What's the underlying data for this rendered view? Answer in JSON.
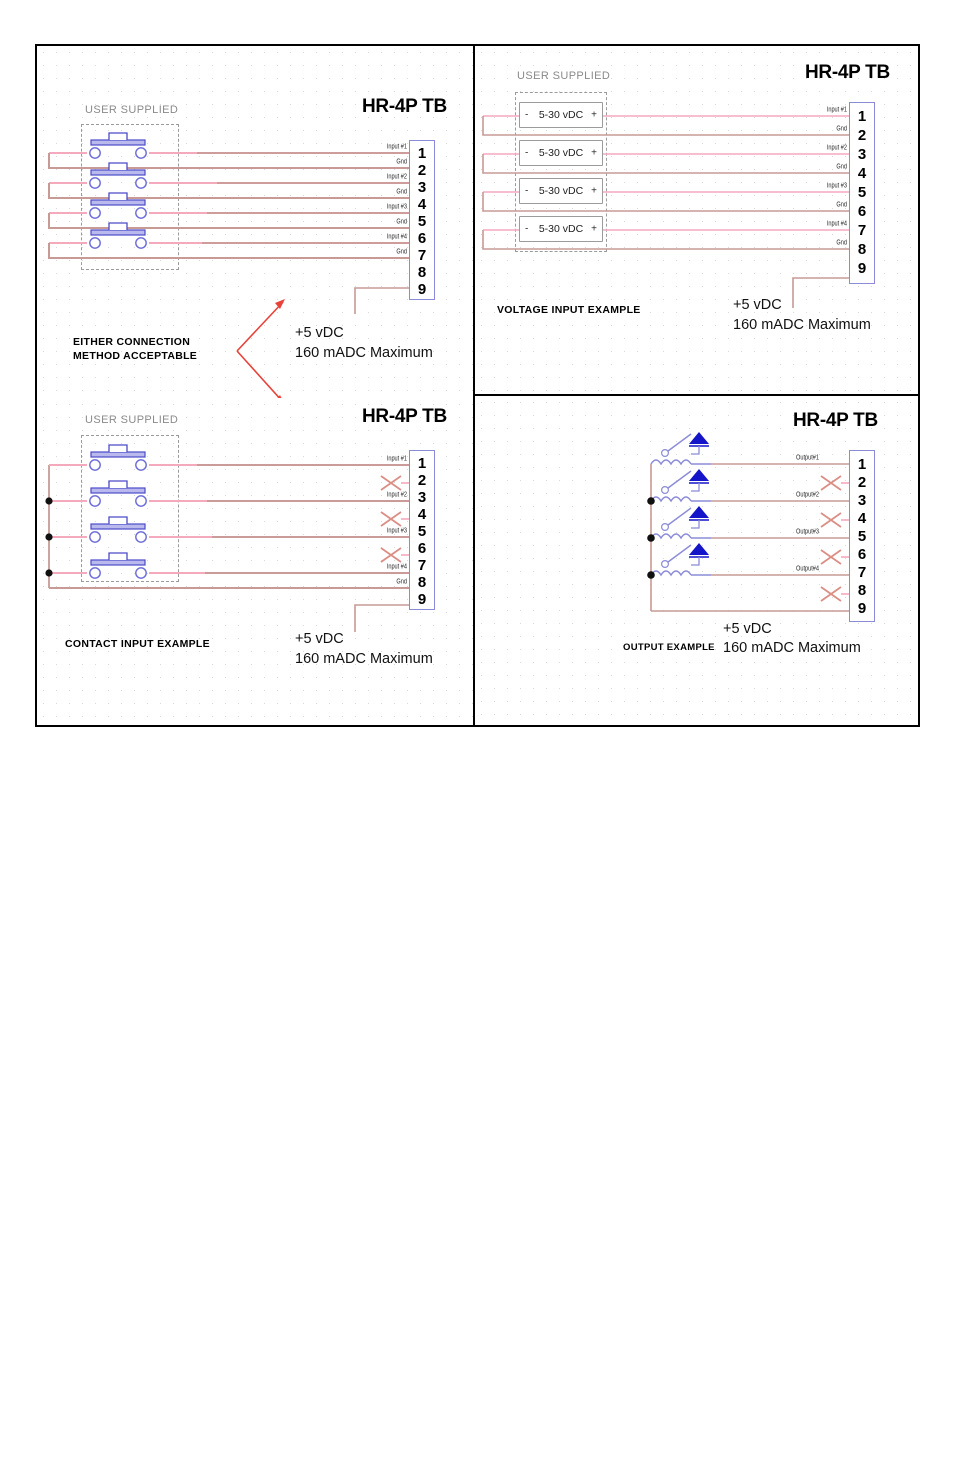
{
  "sheet": {
    "tb_title": "HR-4P TB",
    "user_supplied": "USER SUPPLIED",
    "power_line1": "+5 vDC",
    "power_line2": "160 mADC Maximum"
  },
  "panels": {
    "either": {
      "caption_line1": "EITHER CONNECTION",
      "caption_line2": "METHOD ACCEPTABLE",
      "tb_title": "HR-4P TB",
      "user_supplied": "USER SUPPLIED",
      "power_line1": "+5 vDC",
      "power_line2": "160 mADC Maximum",
      "pins": [
        "1",
        "2",
        "3",
        "4",
        "5",
        "6",
        "7",
        "8",
        "9"
      ],
      "pin_labels": [
        "Input #1",
        "Gnd",
        "Input #2",
        "Gnd",
        "Input #3",
        "Gnd",
        "Input #4",
        "Gnd",
        ""
      ],
      "switch_count": 4
    },
    "voltage": {
      "caption": "VOLTAGE INPUT EXAMPLE",
      "tb_title": "HR-4P TB",
      "user_supplied": "USER SUPPLIED",
      "power_line1": "+5 vDC",
      "power_line2": "160 mADC Maximum",
      "pins": [
        "1",
        "2",
        "3",
        "4",
        "5",
        "6",
        "7",
        "8",
        "9"
      ],
      "pin_labels": [
        "Input #1",
        "Gnd",
        "Input #2",
        "Gnd",
        "Input #3",
        "Gnd",
        "Input #4",
        "Gnd",
        ""
      ],
      "sources": [
        {
          "minus": "-",
          "label": "5-30 vDC",
          "plus": "+"
        },
        {
          "minus": "-",
          "label": "5-30 vDC",
          "plus": "+"
        },
        {
          "minus": "-",
          "label": "5-30 vDC",
          "plus": "+"
        },
        {
          "minus": "-",
          "label": "5-30 vDC",
          "plus": "+"
        }
      ]
    },
    "contact": {
      "caption": "CONTACT INPUT EXAMPLE",
      "tb_title": "HR-4P TB",
      "user_supplied": "USER SUPPLIED",
      "power_line1": "+5 vDC",
      "power_line2": "160 mADC Maximum",
      "pins": [
        "1",
        "2",
        "3",
        "4",
        "5",
        "6",
        "7",
        "8",
        "9"
      ],
      "pin_labels": [
        "Input #1",
        "",
        "Input #2",
        "",
        "Input #3",
        "",
        "Input #4",
        "Gnd",
        ""
      ],
      "unused_pins": [
        "2",
        "4",
        "6"
      ],
      "switch_count": 4
    },
    "output": {
      "caption": "OUTPUT EXAMPLE",
      "tb_title": "HR-4P TB",
      "power_line1": "+5 vDC",
      "power_line2": "160 mADC Maximum",
      "pins": [
        "1",
        "2",
        "3",
        "4",
        "5",
        "6",
        "7",
        "8",
        "9"
      ],
      "pin_labels": [
        "Output#1",
        "",
        "Output#2",
        "",
        "Output#3",
        "",
        "Output#4",
        "",
        ""
      ],
      "unused_pins": [
        "2",
        "4",
        "6",
        "8"
      ],
      "relay_count": 4
    }
  },
  "colors": {
    "wire_pink": "#f4a9bd",
    "wire_rose": "#c79a96",
    "terminal_border": "#8b8bd8",
    "switch_blue": "#4b4bc8",
    "diode_blue": "#1414c8",
    "arrow_red": "#e8423a",
    "user_supplied_grey": "#8a8a8a"
  }
}
